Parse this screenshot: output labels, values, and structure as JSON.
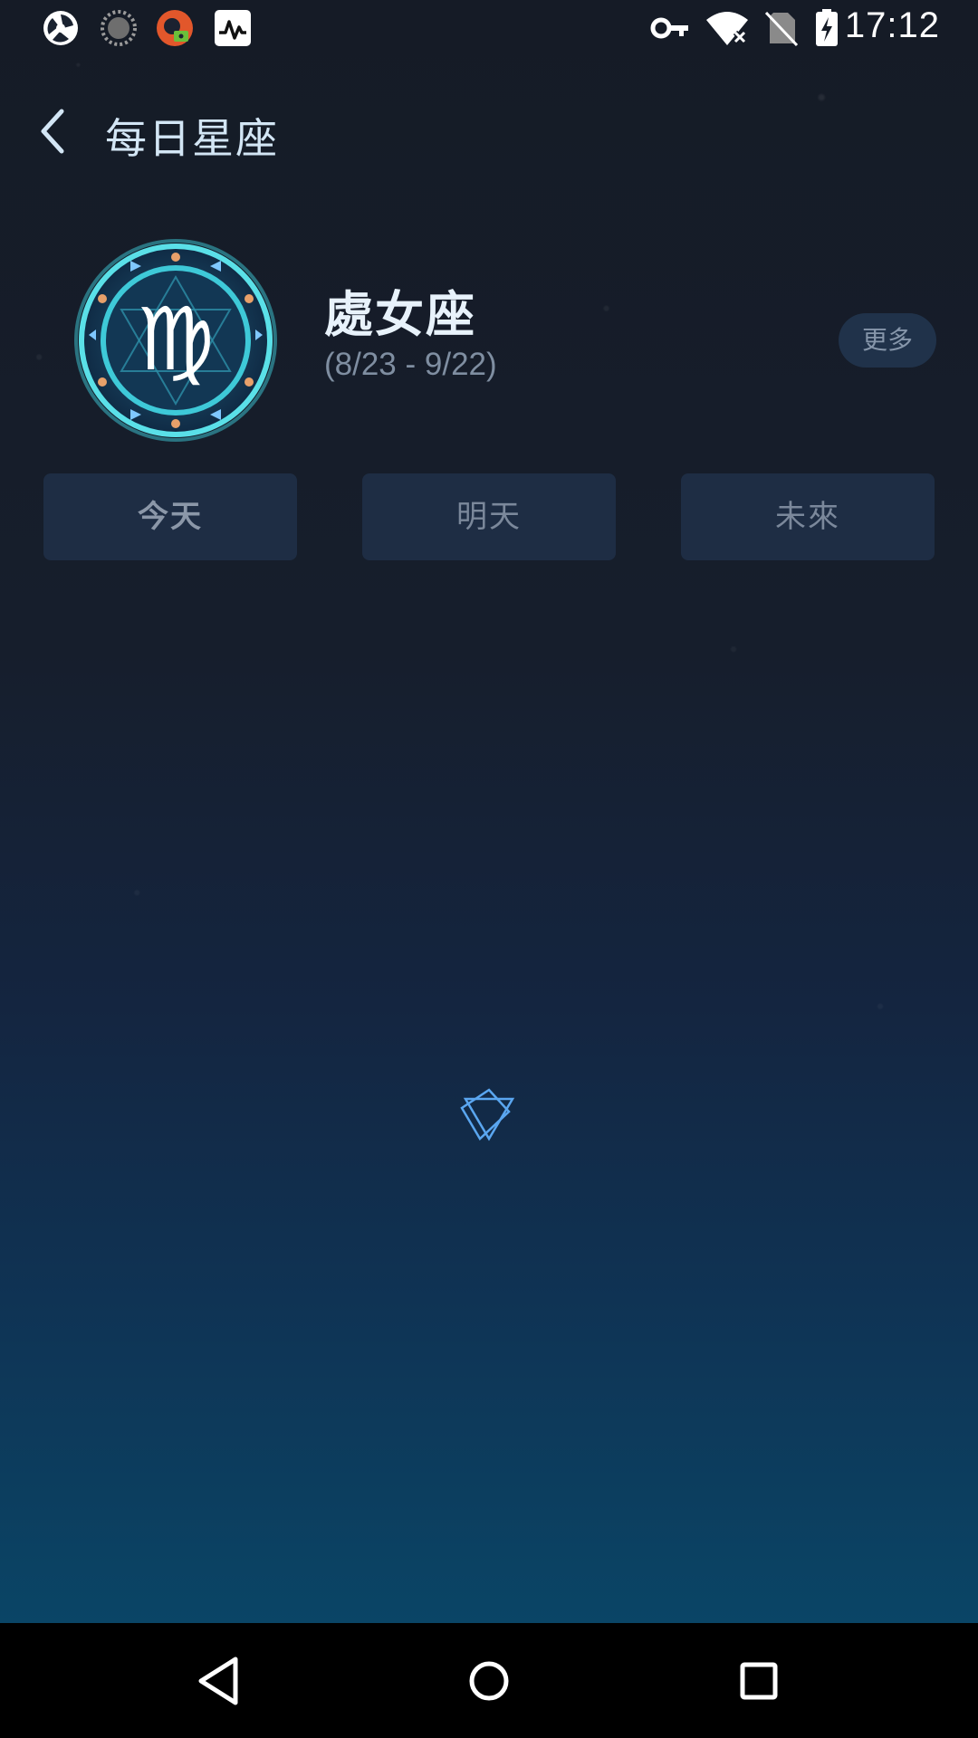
{
  "status_bar": {
    "time": "17:12",
    "left_icons": [
      "camera-aperture-icon",
      "loading-circle-icon",
      "vpn-app-icon",
      "activity-monitor-icon"
    ],
    "right_icons": [
      "vpn-key-icon",
      "wifi-off-icon",
      "no-sim-icon",
      "battery-charging-icon"
    ]
  },
  "header": {
    "title": "每日星座",
    "back_icon": "chevron-left-icon"
  },
  "sign": {
    "symbol": "♍",
    "name": "處女座",
    "dates": "(8/23 - 9/22)",
    "more_label": "更多"
  },
  "tabs": [
    {
      "label": "今天",
      "selected": true
    },
    {
      "label": "明天",
      "selected": false
    },
    {
      "label": "未來",
      "selected": false
    }
  ],
  "loading": {
    "icon": "star-outline-icon"
  },
  "nav_bar": {
    "icons": [
      "back-triangle-icon",
      "home-circle-icon",
      "recents-square-icon"
    ]
  },
  "colors": {
    "accent": "#3ec9d8",
    "title_text": "#d3e6f5",
    "tab_bg": "#1e2d44",
    "more_bg": "#20324a"
  }
}
